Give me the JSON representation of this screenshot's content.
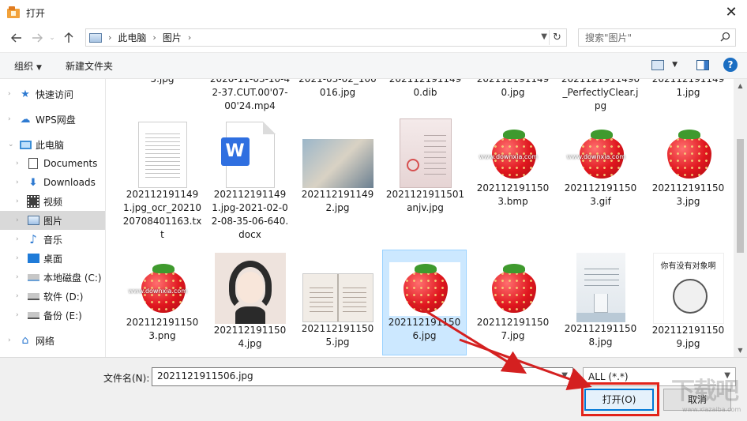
{
  "window": {
    "title": "打开",
    "close_glyph": "✕"
  },
  "address": {
    "crumbs": [
      "此电脑",
      "图片"
    ],
    "separator": "›",
    "refresh_glyph": "↻"
  },
  "search": {
    "placeholder": "搜索\"图片\""
  },
  "toolbar": {
    "organize": "组织",
    "new_folder": "新建文件夹",
    "help": "?"
  },
  "nav": {
    "items": [
      {
        "label": "快速访问"
      },
      {
        "label": "WPS网盘"
      },
      {
        "label": "此电脑"
      },
      {
        "label": "Documents"
      },
      {
        "label": "Downloads"
      },
      {
        "label": "视频"
      },
      {
        "label": "图片"
      },
      {
        "label": "音乐"
      },
      {
        "label": "桌面"
      },
      {
        "label": "本地磁盘 (C:)"
      },
      {
        "label": "软件 (D:)"
      },
      {
        "label": "备份 (E:)"
      },
      {
        "label": "网络"
      }
    ]
  },
  "files": {
    "row0": [
      "5.jpg",
      "2020-11-03-10-42-37.CUT.00'07-00'24.mp4",
      "2021-03-02_100016.jpg",
      "2021121911490.dib",
      "2021121911490.jpg",
      "2021121911490_PerfectlyClear.jpg",
      "2021121911491.jpg"
    ],
    "row1": [
      "2021121911491.jpg_ocr_2021020708401163.txt",
      "2021121911491.jpg-2021-02-02-08-35-06-640.docx",
      "2021121911492.jpg",
      "2021121911501anjv.jpg",
      "2021121911503.bmp",
      "2021121911503.gif",
      "2021121911503.jpg"
    ],
    "row2": [
      "2021121911503.png",
      "2021121911504.jpg",
      "2021121911505.jpg",
      "2021121911506.jpg",
      "2021121911507.jpg",
      "2021121911508.jpg",
      "2021121911509.jpg"
    ],
    "docx_letter": "W",
    "meme_caption": "你有没有对象啊",
    "strawberry_watermark": "www.downxia.com"
  },
  "bottom": {
    "filename_label": "文件名(N):",
    "filename_value": "2021121911506.jpg",
    "filter_value": "ALL (*.*)",
    "open_label": "打开(O)",
    "cancel_label": "取消"
  },
  "brand_watermark": {
    "text": "下载吧",
    "url": "www.xiazaiba.com"
  },
  "colors": {
    "selection": "#cce8ff",
    "annotation_red": "#e2231a",
    "accent": "#0078d7"
  }
}
